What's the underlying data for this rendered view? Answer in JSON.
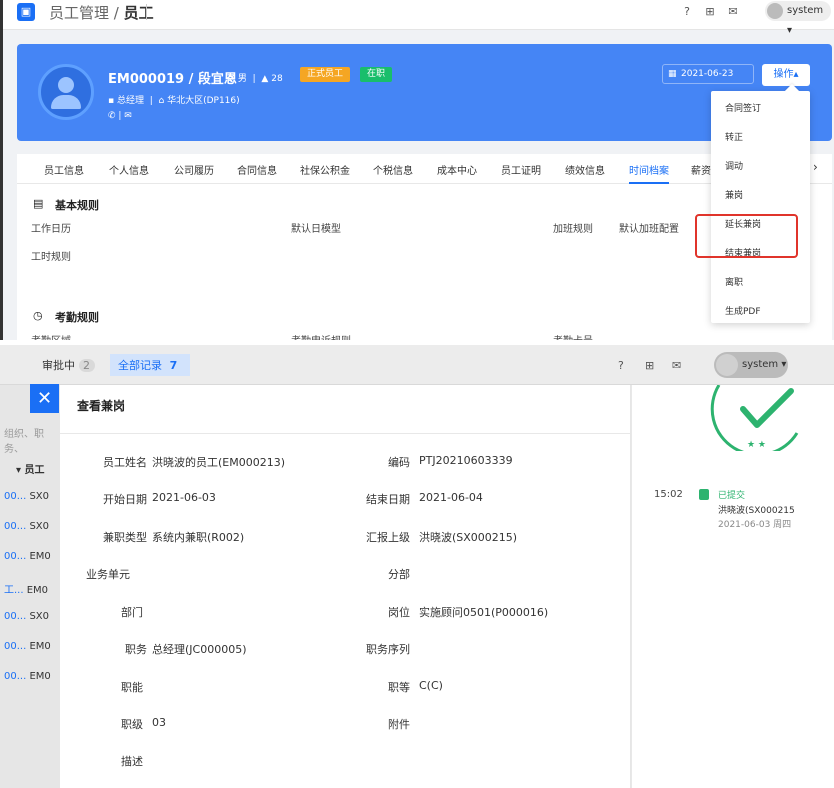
{
  "top": {
    "logo_glyph": "▣",
    "breadcrumb_parent": "员工管理",
    "breadcrumb_current": "员工",
    "toolbar_icons": [
      "help-icon",
      "export-icon",
      "mail-icon"
    ],
    "user_name": "system",
    "profile": {
      "name_line": "EM000019 / 段宜恩",
      "gender": "♂ 男",
      "age": "28",
      "tag_formal": "正式员工",
      "tag_status": "在职",
      "position": "总经理",
      "department": "华北大区(DP116)",
      "contact_icons": "✆  |  ✉",
      "date": "2021-06-23",
      "action_label": "操作"
    },
    "tabs": [
      "员工信息",
      "个人信息",
      "公司履历",
      "合同信息",
      "社保公积金",
      "个税信息",
      "成本中心",
      "员工证明",
      "绩效信息",
      "时间档案",
      "薪资"
    ],
    "active_tab": "时间档案",
    "basic_rules": {
      "title": "基本规则",
      "work_calendar": "工作日历",
      "default_model": "默认日模型",
      "overtime_rule": "加班规则",
      "default_overtime": "默认加班配置",
      "hours_rule": "工时规则"
    },
    "attendance_rules": {
      "title": "考勤规则",
      "area": "考勤区域",
      "appeal": "考勤申诉规则",
      "card_no": "考勤卡号"
    },
    "dropdown_items": [
      "合同签订",
      "转正",
      "调动",
      "兼岗",
      "延长兼岗",
      "结束兼岗",
      "离职",
      "生成PDF"
    ]
  },
  "bottom": {
    "tab_pending": "审批中",
    "tab_pending_count": "2",
    "tab_all": "全部记录",
    "tab_all_count": "7",
    "user_name": "system",
    "left_list": {
      "search_hint": "组织、职务、",
      "header": "员工",
      "rows": [
        {
          "a": "00...",
          "b": "SX0"
        },
        {
          "a": "00...",
          "b": "SX0"
        },
        {
          "a": "00...",
          "b": "EM0"
        },
        {
          "a": "工...",
          "b": "EM0"
        },
        {
          "a": "00...",
          "b": "SX0"
        },
        {
          "a": "00...",
          "b": "EM0"
        },
        {
          "a": "00...",
          "b": "EM0"
        }
      ]
    },
    "drawer": {
      "title": "查看兼岗",
      "fields": {
        "employee_label": "员工姓名",
        "employee_value": "洪晓波的员工(EM000213)",
        "code_label": "编码",
        "code_value": "PTJ20210603339",
        "start_label": "开始日期",
        "start_value": "2021-06-03",
        "end_label": "结束日期",
        "end_value": "2021-06-04",
        "type_label": "兼职类型",
        "type_value": "系统内兼职(R002)",
        "report_label": "汇报上级",
        "report_value": "洪晓波(SX000215)",
        "bu_label": "业务单元",
        "branch_label": "分部",
        "dept_label": "部门",
        "post_label": "岗位",
        "post_value": "实施顾问0501(P000016)",
        "job_label": "职务",
        "job_value": "总经理(JC000005)",
        "job_seq_label": "职务序列",
        "func_label": "职能",
        "grade_label": "职等",
        "grade_value": "C(C)",
        "level_label": "职级",
        "level_value": "03",
        "attach_label": "附件",
        "desc_label": "描述"
      }
    },
    "timeline": {
      "time": "15:02",
      "status": "已提交",
      "who": "洪晓波(SX000215",
      "date": "2021-06-03 周四"
    }
  },
  "colors": {
    "brand": "#1a6ff5",
    "hero": "#4585f5",
    "success": "#2db36f",
    "highlight": "#e0342b",
    "tag_formal": "#f5a623",
    "tag_status": "#19be6b"
  }
}
